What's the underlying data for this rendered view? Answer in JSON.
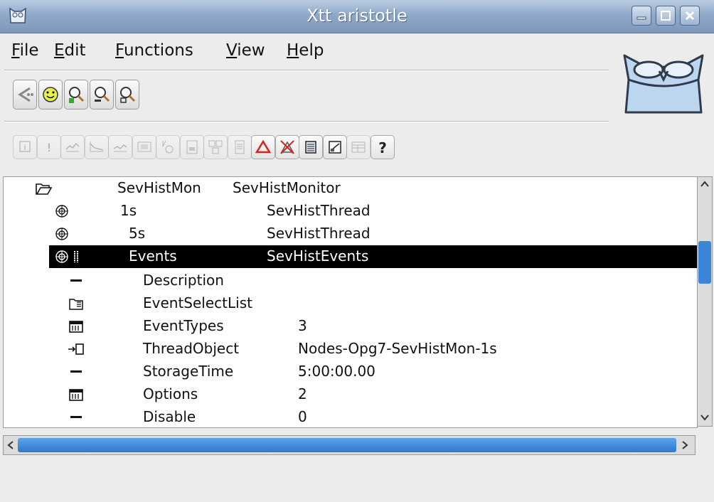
{
  "window": {
    "title": "Xtt aristotle",
    "controls": [
      "minimize",
      "maximize",
      "close"
    ]
  },
  "menu": {
    "items": [
      {
        "mnemonic": "F",
        "rest": "ile"
      },
      {
        "mnemonic": "E",
        "rest": "dit"
      },
      {
        "mnemonic": "F",
        "rest": "unctions"
      },
      {
        "mnemonic": "V",
        "rest": "iew"
      },
      {
        "mnemonic": "H",
        "rest": "elp"
      }
    ]
  },
  "toolbar_nav": [
    "back-icon",
    "smiley-icon",
    "zoom-in-icon",
    "zoom-out-icon",
    "zoom-reset-icon"
  ],
  "toolbar_objects": [
    {
      "icon": "info-icon",
      "enabled": false
    },
    {
      "icon": "exclamation-icon",
      "enabled": false
    },
    {
      "icon": "trend-icon",
      "enabled": false
    },
    {
      "icon": "fast-curve-icon",
      "enabled": false
    },
    {
      "icon": "history-icon",
      "enabled": false
    },
    {
      "icon": "graph-icon",
      "enabled": false
    },
    {
      "icon": "flow-icon",
      "enabled": false
    },
    {
      "icon": "plc-icon",
      "enabled": false
    },
    {
      "icon": "crossref-icon",
      "enabled": false
    },
    {
      "icon": "document-icon",
      "enabled": false
    },
    {
      "icon": "alarm-triangle-icon",
      "enabled": true,
      "color": "#d22424"
    },
    {
      "icon": "block-alarm-icon",
      "enabled": true
    },
    {
      "icon": "list-icon",
      "enabled": true
    },
    {
      "icon": "chart-edit-icon",
      "enabled": true
    },
    {
      "icon": "table-icon",
      "enabled": false
    },
    {
      "icon": "help-icon",
      "enabled": true
    }
  ],
  "tree": {
    "rows": [
      {
        "icon": "folder-open-icon",
        "name": "SevHistMon",
        "class": "SevHistMonitor",
        "value": ""
      },
      {
        "icon": "leaf-icon",
        "name": "1s",
        "class": "SevHistThread",
        "value": ""
      },
      {
        "icon": "leaf-icon",
        "name": "5s",
        "class": "SevHistThread",
        "value": ""
      },
      {
        "icon": "leaf-icon",
        "name": "Events",
        "class": "SevHistEvents",
        "value": "",
        "selected": true
      },
      {
        "icon": "attr-icon",
        "name": "Description",
        "class": "",
        "value": ""
      },
      {
        "icon": "attr-list-icon",
        "name": "EventSelectList",
        "class": "",
        "value": ""
      },
      {
        "icon": "attr-mask-icon",
        "name": "EventTypes",
        "class": "",
        "value": "3"
      },
      {
        "icon": "attr-ref-icon",
        "name": "ThreadObject",
        "class": "",
        "value": "Nodes-Opg7-SevHistMon-1s"
      },
      {
        "icon": "attr-icon",
        "name": "StorageTime",
        "class": "",
        "value": "5:00:00.00"
      },
      {
        "icon": "attr-mask-icon",
        "name": "Options",
        "class": "",
        "value": "2"
      },
      {
        "icon": "attr-icon",
        "name": "Disable",
        "class": "",
        "value": "0"
      }
    ]
  },
  "colors": {
    "titlebar": "#8fa9c9",
    "selection": "#000000",
    "scroll_thumb": "#3b86d8",
    "alarm": "#d22424"
  }
}
